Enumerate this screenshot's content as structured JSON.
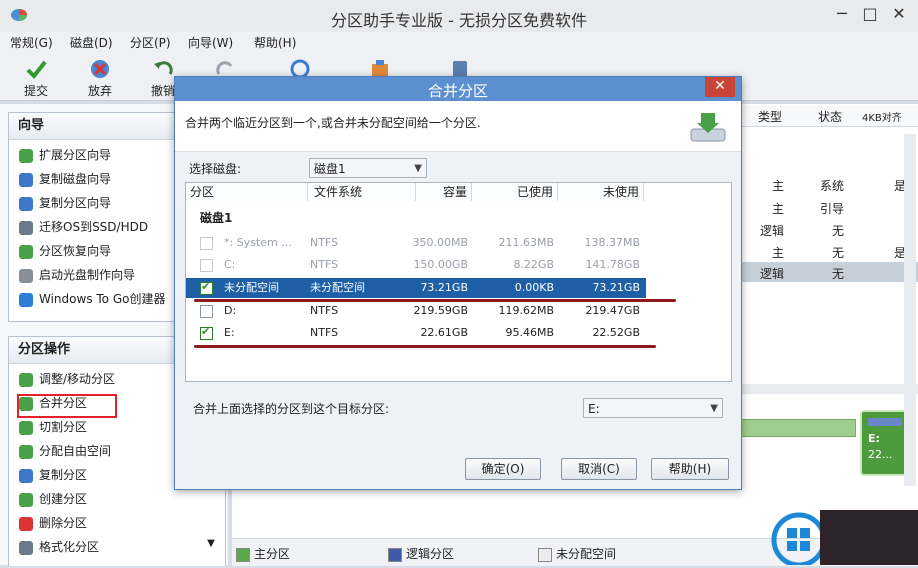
{
  "window": {
    "title": "分区助手专业版 - 无损分区免费软件"
  },
  "menu": [
    "常规(G)",
    "磁盘(D)",
    "分区(P)",
    "向导(W)",
    "帮助(H)"
  ],
  "toolbar": {
    "commit": "提交",
    "discard": "放弃",
    "undo": "撤销"
  },
  "wizard": {
    "title": "向导",
    "items": [
      "扩展分区向导",
      "复制磁盘向导",
      "复制分区向导",
      "迁移OS到SSD/HDD",
      "分区恢复向导",
      "启动光盘制作向导",
      "Windows To Go创建器"
    ]
  },
  "ops": {
    "title": "分区操作",
    "items": [
      "调整/移动分区",
      "合并分区",
      "切割分区",
      "分配自由空间",
      "复制分区",
      "创建分区",
      "删除分区",
      "格式化分区"
    ]
  },
  "bg": {
    "headers": [
      "类型",
      "状态",
      "4KB对齐"
    ],
    "rows": [
      [
        "主",
        "系统",
        "是"
      ],
      [
        "主",
        "引导",
        ""
      ],
      [
        "逻辑",
        "无",
        ""
      ],
      [
        "主",
        "无",
        "是"
      ],
      [
        "逻辑",
        "无",
        ""
      ]
    ],
    "disk_e_label": "E:",
    "disk_e_size": "22..."
  },
  "dialog": {
    "title": "合并分区",
    "close": "✕",
    "description": "合并两个临近分区到一个,或合并未分配空间给一个分区.",
    "select_disk_label": "选择磁盘:",
    "select_disk_value": "磁盘1",
    "columns": [
      "分区",
      "文件系统",
      "容量",
      "已使用",
      "未使用"
    ],
    "disk_group": "磁盘1",
    "rows": [
      {
        "name": "*: System ...",
        "fs": "NTFS",
        "cap": "350.00MB",
        "used": "211.63MB",
        "free": "138.37MB",
        "checked": false,
        "enabled": false,
        "selected": false
      },
      {
        "name": "C:",
        "fs": "NTFS",
        "cap": "150.00GB",
        "used": "8.22GB",
        "free": "141.78GB",
        "checked": false,
        "enabled": false,
        "selected": false
      },
      {
        "name": "未分配空间",
        "fs": "未分配空间",
        "cap": "73.21GB",
        "used": "0.00KB",
        "free": "73.21GB",
        "checked": true,
        "enabled": true,
        "selected": true
      },
      {
        "name": "D:",
        "fs": "NTFS",
        "cap": "219.59GB",
        "used": "119.62MB",
        "free": "219.47GB",
        "checked": false,
        "enabled": true,
        "selected": false
      },
      {
        "name": "E:",
        "fs": "NTFS",
        "cap": "22.61GB",
        "used": "95.46MB",
        "free": "22.52GB",
        "checked": true,
        "enabled": true,
        "selected": false
      }
    ],
    "target_label": "合并上面选择的分区到这个目标分区:",
    "target_value": "E:",
    "ok": "确定(O)",
    "cancel": "取消(C)",
    "help": "帮助(H)"
  },
  "legend": [
    "主分区",
    "逻辑分区",
    "未分配空间"
  ],
  "colors": {
    "primary": "#5aa84a",
    "logical": "#3f5ba8",
    "unallocated": "#ececec",
    "selection": "#1f5fa6",
    "accent_red": "#e0242a"
  }
}
